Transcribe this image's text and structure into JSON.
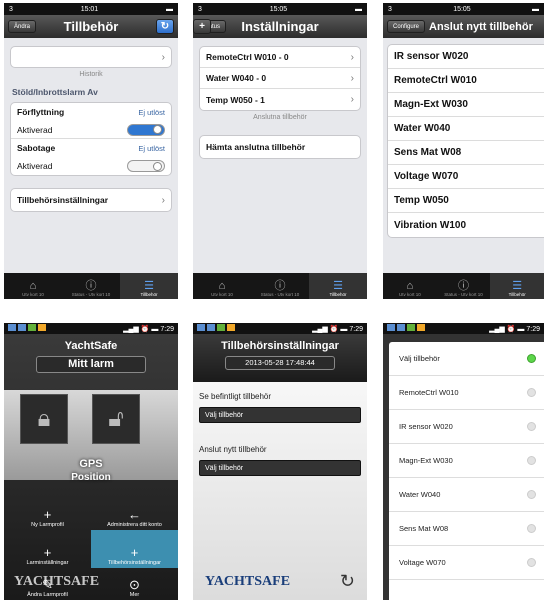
{
  "screen1": {
    "status": {
      "carrier": "3",
      "time": "15:01"
    },
    "nav": {
      "left_button": "Ändra",
      "title": "Tillbehör",
      "right_icon": "refresh-icon"
    },
    "history_label": "Historik",
    "alarm_header": "Stöld/Inbrottslarm Av",
    "movement": {
      "label": "Förflyttning",
      "state": "Ej utlöst",
      "sub_label": "Aktiverad",
      "toggle_on": true
    },
    "sabotage": {
      "label": "Sabotage",
      "state": "Ej utlöst",
      "sub_label": "Aktiverad",
      "toggle_on": false
    },
    "settings_row": "Tillbehörsinställningar"
  },
  "screen2": {
    "status": {
      "carrier": "3",
      "time": "15:05"
    },
    "nav": {
      "left_button": "Status",
      "title": "Inställningar",
      "right_icon": "plus-icon"
    },
    "accessories": [
      "RemoteCtrl W010 - 0",
      "Water W040 - 0",
      "Temp W050 - 1"
    ],
    "connected_label": "Anslutna tillbehör",
    "fetch_button": "Hämta anslutna tillbehör"
  },
  "screen3": {
    "status": {
      "carrier": "3",
      "time": "15:05"
    },
    "nav": {
      "left_button": "Configure",
      "title": "Anslut nytt tillbehör"
    },
    "items": [
      "IR sensor W020",
      "RemoteCtrl W010",
      "Magn-Ext W030",
      "Water W040",
      "Sens Mat W08",
      "Voltage W070",
      "Temp W050",
      "Vibration W100"
    ]
  },
  "tabbar": {
    "tabs": [
      "Utv kort 10",
      "Status - Utv kort 10",
      "Tillbehör"
    ],
    "tabs_s1": [
      "Utv kort 10",
      "Status - Utv kort 10",
      "Tillbehör"
    ]
  },
  "screen4": {
    "time": "7:29",
    "app_title": "YachtSafe",
    "main_button": "Mitt larm",
    "gps_label": "GPS",
    "position_label": "Position",
    "grid": [
      {
        "label": "Ny Larmprofil",
        "icon": "+"
      },
      {
        "label": "Administrera ditt konto",
        "icon": "←"
      },
      {
        "label": "Larminställningar",
        "icon": "+"
      },
      {
        "label": "Tillbehörsinställningar",
        "icon": "+"
      },
      {
        "label": "Ändra Larmprofil",
        "icon": "✎"
      },
      {
        "label": "Mer",
        "icon": "⊙"
      }
    ],
    "logo": "YACHTSAFE"
  },
  "screen5": {
    "time": "7:29",
    "title": "Tillbehörsinställningar",
    "timestamp": "2013-05-28 17:48:44",
    "existing_label": "Se befintligt tillbehör",
    "existing_select": "Välj tillbehör",
    "connect_label": "Anslut nytt tillbehör",
    "connect_select": "Välj tillbehör",
    "logo": "YACHTSAFE"
  },
  "screen6": {
    "time": "7:29",
    "items": [
      "Välj tillbehör",
      "RemoteCtrl W010",
      "IR sensor W020",
      "Magn-Ext W030",
      "Water W040",
      "Sens Mat W08",
      "Voltage W070"
    ],
    "selected_index": 0
  },
  "colors": {
    "ios_blue": "#2f77d1",
    "android_teal": "#3d8fb0",
    "radio_green": "#5cd64a"
  }
}
